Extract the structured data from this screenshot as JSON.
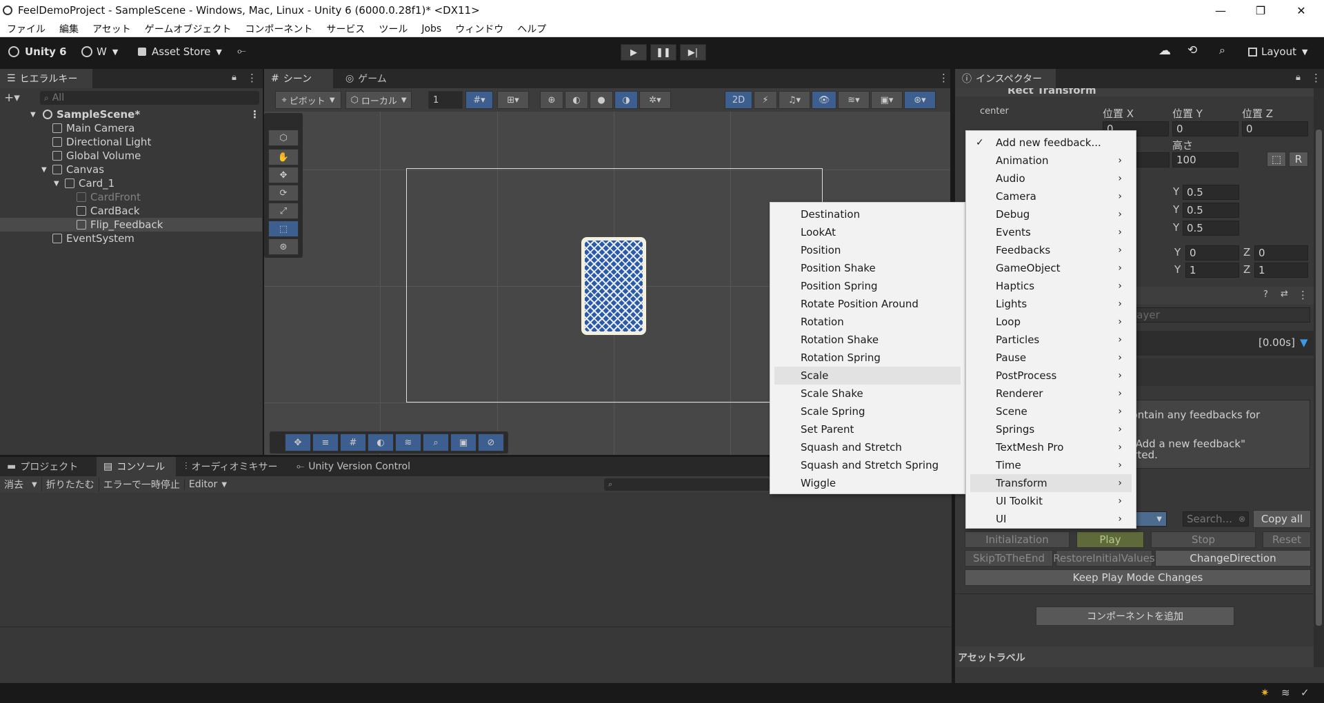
{
  "window": {
    "title": "FeelDemoProject - SampleScene - Windows, Mac, Linux - Unity 6 (6000.0.28f1)* <DX11>"
  },
  "menubar": [
    "ファイル",
    "編集",
    "アセット",
    "ゲームオブジェクト",
    "コンポーネント",
    "サービス",
    "ツール",
    "Jobs",
    "ウィンドウ",
    "ヘルプ"
  ],
  "toolbar": {
    "unity_label": "Unity 6",
    "account": "W",
    "asset_store": "Asset Store",
    "layout": "Layout"
  },
  "hierarchy": {
    "tab": "ヒエラルキー",
    "search_placeholder": "All",
    "items": [
      {
        "label": "SampleScene*",
        "indent": 0
      },
      {
        "label": "Main Camera",
        "indent": 1
      },
      {
        "label": "Directional Light",
        "indent": 1
      },
      {
        "label": "Global Volume",
        "indent": 1
      },
      {
        "label": "Canvas",
        "indent": 1
      },
      {
        "label": "Card_1",
        "indent": 2
      },
      {
        "label": "CardFront",
        "indent": 3
      },
      {
        "label": "CardBack",
        "indent": 3
      },
      {
        "label": "Flip_Feedback",
        "indent": 3
      },
      {
        "label": "EventSystem",
        "indent": 1
      }
    ]
  },
  "scene": {
    "tabs": [
      "シーン",
      "ゲーム"
    ],
    "pivot": "ピボット",
    "local": "ローカル",
    "grid_value": "1",
    "mode_2d": "2D"
  },
  "console": {
    "tabs": [
      "プロジェクト",
      "コンソール",
      "オーディオミキサー",
      "Unity Version Control"
    ],
    "buttons": [
      "消去",
      "折りたたむ",
      "エラーで一時停止",
      "Editor"
    ]
  },
  "inspector": {
    "tab": "インスペクター",
    "component": "Rect Transform",
    "anchor": "center",
    "pos_labels": [
      "位置 X",
      "位置 Y",
      "位置 Z"
    ],
    "pos_values": [
      "0",
      "0",
      "0"
    ],
    "height_label": "高さ",
    "height_value": "100",
    "r_label": "R",
    "pivot_y": [
      "0.5",
      "0.5",
      "0.5"
    ],
    "rot": [
      "0",
      "0"
    ],
    "scale": [
      "1",
      "1"
    ],
    "y_label": "Y",
    "z_label": "Z",
    "player_field": "MF_Player",
    "duration": "[0.00s]",
    "help_text_1": "esn't contain any feedbacks for",
    "help_text_2": "m the \"Add a new feedback\"",
    "help_text_3": "get started.",
    "search_placeholder": "Search...",
    "copy_all": "Copy all",
    "controls": [
      "Initialization",
      "Play",
      "Stop",
      "Reset"
    ],
    "controls2": [
      "SkipToTheEnd",
      "RestoreInitialValues",
      "ChangeDirection"
    ],
    "keep": "Keep Play Mode Changes",
    "add_component": "コンポーネントを追加",
    "asset_labels": "アセットラベル"
  },
  "feedback_menu": {
    "items": [
      "Add new feedback...",
      "Animation",
      "Audio",
      "Camera",
      "Debug",
      "Events",
      "Feedbacks",
      "GameObject",
      "Haptics",
      "Lights",
      "Loop",
      "Particles",
      "Pause",
      "PostProcess",
      "Renderer",
      "Scene",
      "Springs",
      "TextMesh Pro",
      "Time",
      "Transform",
      "UI Toolkit",
      "UI"
    ],
    "highlighted": "Transform"
  },
  "transform_submenu": {
    "items": [
      "Destination",
      "LookAt",
      "Position",
      "Position Shake",
      "Position Spring",
      "Rotate Position Around",
      "Rotation",
      "Rotation Shake",
      "Rotation Spring",
      "Scale",
      "Scale Shake",
      "Scale Spring",
      "Set Parent",
      "Squash and Stretch",
      "Squash and Stretch Spring",
      "Wiggle"
    ],
    "highlighted": "Scale"
  },
  "colors": {
    "accent": "#3d5f8f",
    "menu_bg": "#f2f2f2",
    "panel_bg": "#383838"
  }
}
